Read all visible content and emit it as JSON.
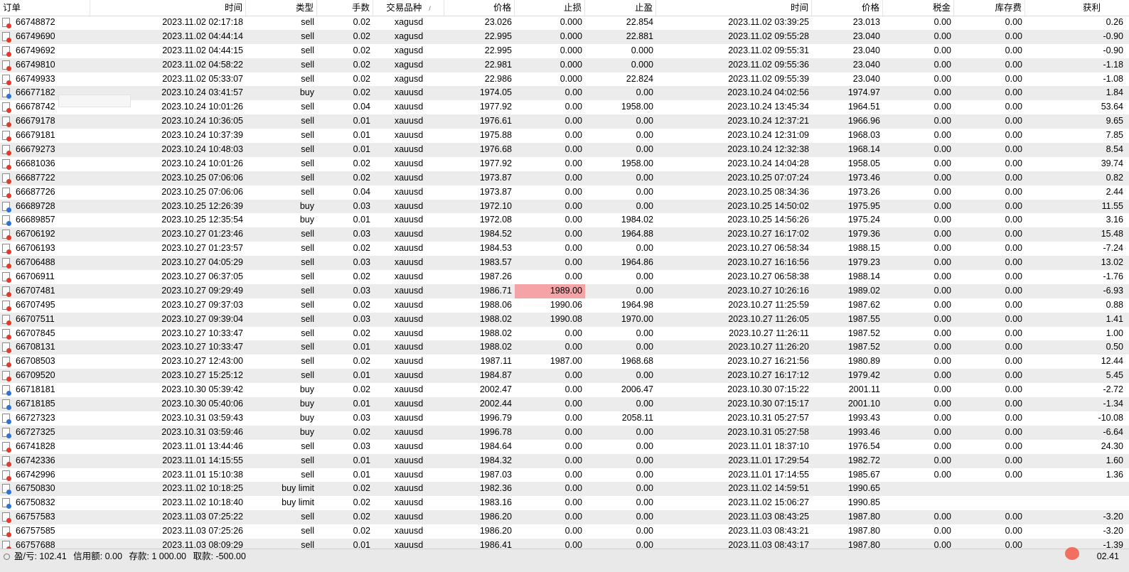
{
  "columns": [
    "订单",
    "时间",
    "类型",
    "手数",
    "交易品种",
    "价格",
    "止损",
    "止盈",
    "时间",
    "价格",
    "税金",
    "库存费",
    "获利"
  ],
  "sort_indicator": "/",
  "rows": [
    {
      "order": "66748872",
      "open_time": "2023.11.02 02:17:18",
      "type": "sell",
      "lots": "0.02",
      "symbol": "xagusd",
      "open_price": "23.026",
      "sl": "0.000",
      "tp": "22.854",
      "close_time": "2023.11.02 03:39:25",
      "close_price": "23.013",
      "tax": "0.00",
      "swap": "0.00",
      "profit": "0.26"
    },
    {
      "order": "66749690",
      "open_time": "2023.11.02 04:44:14",
      "type": "sell",
      "lots": "0.02",
      "symbol": "xagusd",
      "open_price": "22.995",
      "sl": "0.000",
      "tp": "22.881",
      "close_time": "2023.11.02 09:55:28",
      "close_price": "23.040",
      "tax": "0.00",
      "swap": "0.00",
      "profit": "-0.90"
    },
    {
      "order": "66749692",
      "open_time": "2023.11.02 04:44:15",
      "type": "sell",
      "lots": "0.02",
      "symbol": "xagusd",
      "open_price": "22.995",
      "sl": "0.000",
      "tp": "0.000",
      "close_time": "2023.11.02 09:55:31",
      "close_price": "23.040",
      "tax": "0.00",
      "swap": "0.00",
      "profit": "-0.90"
    },
    {
      "order": "66749810",
      "open_time": "2023.11.02 04:58:22",
      "type": "sell",
      "lots": "0.02",
      "symbol": "xagusd",
      "open_price": "22.981",
      "sl": "0.000",
      "tp": "0.000",
      "close_time": "2023.11.02 09:55:36",
      "close_price": "23.040",
      "tax": "0.00",
      "swap": "0.00",
      "profit": "-1.18"
    },
    {
      "order": "66749933",
      "open_time": "2023.11.02 05:33:07",
      "type": "sell",
      "lots": "0.02",
      "symbol": "xagusd",
      "open_price": "22.986",
      "sl": "0.000",
      "tp": "22.824",
      "close_time": "2023.11.02 09:55:39",
      "close_price": "23.040",
      "tax": "0.00",
      "swap": "0.00",
      "profit": "-1.08"
    },
    {
      "order": "66677182",
      "open_time": "2023.10.24 03:41:57",
      "type": "buy",
      "lots": "0.02",
      "symbol": "xauusd",
      "open_price": "1974.05",
      "sl": "0.00",
      "tp": "0.00",
      "close_time": "2023.10.24 04:02:56",
      "close_price": "1974.97",
      "tax": "0.00",
      "swap": "0.00",
      "profit": "1.84"
    },
    {
      "order": "66678742",
      "open_time": "2023.10.24 10:01:26",
      "type": "sell",
      "lots": "0.04",
      "symbol": "xauusd",
      "open_price": "1977.92",
      "sl": "0.00",
      "tp": "1958.00",
      "close_time": "2023.10.24 13:45:34",
      "close_price": "1964.51",
      "tax": "0.00",
      "swap": "0.00",
      "profit": "53.64"
    },
    {
      "order": "66679178",
      "open_time": "2023.10.24 10:36:05",
      "type": "sell",
      "lots": "0.01",
      "symbol": "xauusd",
      "open_price": "1976.61",
      "sl": "0.00",
      "tp": "0.00",
      "close_time": "2023.10.24 12:37:21",
      "close_price": "1966.96",
      "tax": "0.00",
      "swap": "0.00",
      "profit": "9.65"
    },
    {
      "order": "66679181",
      "open_time": "2023.10.24 10:37:39",
      "type": "sell",
      "lots": "0.01",
      "symbol": "xauusd",
      "open_price": "1975.88",
      "sl": "0.00",
      "tp": "0.00",
      "close_time": "2023.10.24 12:31:09",
      "close_price": "1968.03",
      "tax": "0.00",
      "swap": "0.00",
      "profit": "7.85"
    },
    {
      "order": "66679273",
      "open_time": "2023.10.24 10:48:03",
      "type": "sell",
      "lots": "0.01",
      "symbol": "xauusd",
      "open_price": "1976.68",
      "sl": "0.00",
      "tp": "0.00",
      "close_time": "2023.10.24 12:32:38",
      "close_price": "1968.14",
      "tax": "0.00",
      "swap": "0.00",
      "profit": "8.54"
    },
    {
      "order": "66681036",
      "open_time": "2023.10.24 10:01:26",
      "type": "sell",
      "lots": "0.02",
      "symbol": "xauusd",
      "open_price": "1977.92",
      "sl": "0.00",
      "tp": "1958.00",
      "close_time": "2023.10.24 14:04:28",
      "close_price": "1958.05",
      "tax": "0.00",
      "swap": "0.00",
      "profit": "39.74"
    },
    {
      "order": "66687722",
      "open_time": "2023.10.25 07:06:06",
      "type": "sell",
      "lots": "0.02",
      "symbol": "xauusd",
      "open_price": "1973.87",
      "sl": "0.00",
      "tp": "0.00",
      "close_time": "2023.10.25 07:07:24",
      "close_price": "1973.46",
      "tax": "0.00",
      "swap": "0.00",
      "profit": "0.82"
    },
    {
      "order": "66687726",
      "open_time": "2023.10.25 07:06:06",
      "type": "sell",
      "lots": "0.04",
      "symbol": "xauusd",
      "open_price": "1973.87",
      "sl": "0.00",
      "tp": "0.00",
      "close_time": "2023.10.25 08:34:36",
      "close_price": "1973.26",
      "tax": "0.00",
      "swap": "0.00",
      "profit": "2.44"
    },
    {
      "order": "66689728",
      "open_time": "2023.10.25 12:26:39",
      "type": "buy",
      "lots": "0.03",
      "symbol": "xauusd",
      "open_price": "1972.10",
      "sl": "0.00",
      "tp": "0.00",
      "close_time": "2023.10.25 14:50:02",
      "close_price": "1975.95",
      "tax": "0.00",
      "swap": "0.00",
      "profit": "11.55"
    },
    {
      "order": "66689857",
      "open_time": "2023.10.25 12:35:54",
      "type": "buy",
      "lots": "0.01",
      "symbol": "xauusd",
      "open_price": "1972.08",
      "sl": "0.00",
      "tp": "1984.02",
      "close_time": "2023.10.25 14:56:26",
      "close_price": "1975.24",
      "tax": "0.00",
      "swap": "0.00",
      "profit": "3.16"
    },
    {
      "order": "66706192",
      "open_time": "2023.10.27 01:23:46",
      "type": "sell",
      "lots": "0.03",
      "symbol": "xauusd",
      "open_price": "1984.52",
      "sl": "0.00",
      "tp": "1964.88",
      "close_time": "2023.10.27 16:17:02",
      "close_price": "1979.36",
      "tax": "0.00",
      "swap": "0.00",
      "profit": "15.48"
    },
    {
      "order": "66706193",
      "open_time": "2023.10.27 01:23:57",
      "type": "sell",
      "lots": "0.02",
      "symbol": "xauusd",
      "open_price": "1984.53",
      "sl": "0.00",
      "tp": "0.00",
      "close_time": "2023.10.27 06:58:34",
      "close_price": "1988.15",
      "tax": "0.00",
      "swap": "0.00",
      "profit": "-7.24"
    },
    {
      "order": "66706488",
      "open_time": "2023.10.27 04:05:29",
      "type": "sell",
      "lots": "0.03",
      "symbol": "xauusd",
      "open_price": "1983.57",
      "sl": "0.00",
      "tp": "1964.86",
      "close_time": "2023.10.27 16:16:56",
      "close_price": "1979.23",
      "tax": "0.00",
      "swap": "0.00",
      "profit": "13.02"
    },
    {
      "order": "66706911",
      "open_time": "2023.10.27 06:37:05",
      "type": "sell",
      "lots": "0.02",
      "symbol": "xauusd",
      "open_price": "1987.26",
      "sl": "0.00",
      "tp": "0.00",
      "close_time": "2023.10.27 06:58:38",
      "close_price": "1988.14",
      "tax": "0.00",
      "swap": "0.00",
      "profit": "-1.76"
    },
    {
      "order": "66707481",
      "open_time": "2023.10.27 09:29:49",
      "type": "sell",
      "lots": "0.03",
      "symbol": "xauusd",
      "open_price": "1986.71",
      "sl": "1989.00",
      "tp": "0.00",
      "close_time": "2023.10.27 10:26:16",
      "close_price": "1989.02",
      "tax": "0.00",
      "swap": "0.00",
      "profit": "-6.93",
      "sl_hit": true
    },
    {
      "order": "66707495",
      "open_time": "2023.10.27 09:37:03",
      "type": "sell",
      "lots": "0.02",
      "symbol": "xauusd",
      "open_price": "1988.06",
      "sl": "1990.06",
      "tp": "1964.98",
      "close_time": "2023.10.27 11:25:59",
      "close_price": "1987.62",
      "tax": "0.00",
      "swap": "0.00",
      "profit": "0.88"
    },
    {
      "order": "66707511",
      "open_time": "2023.10.27 09:39:04",
      "type": "sell",
      "lots": "0.03",
      "symbol": "xauusd",
      "open_price": "1988.02",
      "sl": "1990.08",
      "tp": "1970.00",
      "close_time": "2023.10.27 11:26:05",
      "close_price": "1987.55",
      "tax": "0.00",
      "swap": "0.00",
      "profit": "1.41"
    },
    {
      "order": "66707845",
      "open_time": "2023.10.27 10:33:47",
      "type": "sell",
      "lots": "0.02",
      "symbol": "xauusd",
      "open_price": "1988.02",
      "sl": "0.00",
      "tp": "0.00",
      "close_time": "2023.10.27 11:26:11",
      "close_price": "1987.52",
      "tax": "0.00",
      "swap": "0.00",
      "profit": "1.00"
    },
    {
      "order": "66708131",
      "open_time": "2023.10.27 10:33:47",
      "type": "sell",
      "lots": "0.01",
      "symbol": "xauusd",
      "open_price": "1988.02",
      "sl": "0.00",
      "tp": "0.00",
      "close_time": "2023.10.27 11:26:20",
      "close_price": "1987.52",
      "tax": "0.00",
      "swap": "0.00",
      "profit": "0.50"
    },
    {
      "order": "66708503",
      "open_time": "2023.10.27 12:43:00",
      "type": "sell",
      "lots": "0.02",
      "symbol": "xauusd",
      "open_price": "1987.11",
      "sl": "1987.00",
      "tp": "1968.68",
      "close_time": "2023.10.27 16:21:56",
      "close_price": "1980.89",
      "tax": "0.00",
      "swap": "0.00",
      "profit": "12.44"
    },
    {
      "order": "66709520",
      "open_time": "2023.10.27 15:25:12",
      "type": "sell",
      "lots": "0.01",
      "symbol": "xauusd",
      "open_price": "1984.87",
      "sl": "0.00",
      "tp": "0.00",
      "close_time": "2023.10.27 16:17:12",
      "close_price": "1979.42",
      "tax": "0.00",
      "swap": "0.00",
      "profit": "5.45"
    },
    {
      "order": "66718181",
      "open_time": "2023.10.30 05:39:42",
      "type": "buy",
      "lots": "0.02",
      "symbol": "xauusd",
      "open_price": "2002.47",
      "sl": "0.00",
      "tp": "2006.47",
      "close_time": "2023.10.30 07:15:22",
      "close_price": "2001.11",
      "tax": "0.00",
      "swap": "0.00",
      "profit": "-2.72"
    },
    {
      "order": "66718185",
      "open_time": "2023.10.30 05:40:06",
      "type": "buy",
      "lots": "0.01",
      "symbol": "xauusd",
      "open_price": "2002.44",
      "sl": "0.00",
      "tp": "0.00",
      "close_time": "2023.10.30 07:15:17",
      "close_price": "2001.10",
      "tax": "0.00",
      "swap": "0.00",
      "profit": "-1.34"
    },
    {
      "order": "66727323",
      "open_time": "2023.10.31 03:59:43",
      "type": "buy",
      "lots": "0.03",
      "symbol": "xauusd",
      "open_price": "1996.79",
      "sl": "0.00",
      "tp": "2058.11",
      "close_time": "2023.10.31 05:27:57",
      "close_price": "1993.43",
      "tax": "0.00",
      "swap": "0.00",
      "profit": "-10.08"
    },
    {
      "order": "66727325",
      "open_time": "2023.10.31 03:59:46",
      "type": "buy",
      "lots": "0.02",
      "symbol": "xauusd",
      "open_price": "1996.78",
      "sl": "0.00",
      "tp": "0.00",
      "close_time": "2023.10.31 05:27:58",
      "close_price": "1993.46",
      "tax": "0.00",
      "swap": "0.00",
      "profit": "-6.64"
    },
    {
      "order": "66741828",
      "open_time": "2023.11.01 13:44:46",
      "type": "sell",
      "lots": "0.03",
      "symbol": "xauusd",
      "open_price": "1984.64",
      "sl": "0.00",
      "tp": "0.00",
      "close_time": "2023.11.01 18:37:10",
      "close_price": "1976.54",
      "tax": "0.00",
      "swap": "0.00",
      "profit": "24.30"
    },
    {
      "order": "66742336",
      "open_time": "2023.11.01 14:15:55",
      "type": "sell",
      "lots": "0.01",
      "symbol": "xauusd",
      "open_price": "1984.32",
      "sl": "0.00",
      "tp": "0.00",
      "close_time": "2023.11.01 17:29:54",
      "close_price": "1982.72",
      "tax": "0.00",
      "swap": "0.00",
      "profit": "1.60"
    },
    {
      "order": "66742996",
      "open_time": "2023.11.01 15:10:38",
      "type": "sell",
      "lots": "0.01",
      "symbol": "xauusd",
      "open_price": "1987.03",
      "sl": "0.00",
      "tp": "0.00",
      "close_time": "2023.11.01 17:14:55",
      "close_price": "1985.67",
      "tax": "0.00",
      "swap": "0.00",
      "profit": "1.36"
    },
    {
      "order": "66750830",
      "open_time": "2023.11.02 10:18:25",
      "type": "buy limit",
      "lots": "0.02",
      "symbol": "xauusd",
      "open_price": "1982.36",
      "sl": "0.00",
      "tp": "0.00",
      "close_time": "2023.11.02 14:59:51",
      "close_price": "1990.65",
      "tax": "",
      "swap": "",
      "profit": ""
    },
    {
      "order": "66750832",
      "open_time": "2023.11.02 10:18:40",
      "type": "buy limit",
      "lots": "0.02",
      "symbol": "xauusd",
      "open_price": "1983.16",
      "sl": "0.00",
      "tp": "0.00",
      "close_time": "2023.11.02 15:06:27",
      "close_price": "1990.85",
      "tax": "",
      "swap": "",
      "profit": ""
    },
    {
      "order": "66757583",
      "open_time": "2023.11.03 07:25:22",
      "type": "sell",
      "lots": "0.02",
      "symbol": "xauusd",
      "open_price": "1986.20",
      "sl": "0.00",
      "tp": "0.00",
      "close_time": "2023.11.03 08:43:25",
      "close_price": "1987.80",
      "tax": "0.00",
      "swap": "0.00",
      "profit": "-3.20"
    },
    {
      "order": "66757585",
      "open_time": "2023.11.03 07:25:26",
      "type": "sell",
      "lots": "0.02",
      "symbol": "xauusd",
      "open_price": "1986.20",
      "sl": "0.00",
      "tp": "0.00",
      "close_time": "2023.11.03 08:43:21",
      "close_price": "1987.80",
      "tax": "0.00",
      "swap": "0.00",
      "profit": "-3.20"
    },
    {
      "order": "66757688",
      "open_time": "2023.11.03 08:09:29",
      "type": "sell",
      "lots": "0.01",
      "symbol": "xauusd",
      "open_price": "1986.41",
      "sl": "0.00",
      "tp": "0.00",
      "close_time": "2023.11.03 08:43:17",
      "close_price": "1987.80",
      "tax": "0.00",
      "swap": "0.00",
      "profit": "-1.39"
    }
  ],
  "status": {
    "pl_label": "盈/亏: 102.41",
    "credit_label": "信用额: 0.00",
    "deposit_label": "存款: 1 000.00",
    "withdraw_label": "取款: -500.00",
    "total": "02.41"
  },
  "colors": {
    "sl_hit_bg": "#f4a3a6",
    "row_alt": "#ececec",
    "sell_dot": "#e03b2b",
    "buy_dot": "#2a74d6"
  },
  "icons": {
    "sell": "sell-order-icon",
    "buy": "buy-order-icon"
  }
}
